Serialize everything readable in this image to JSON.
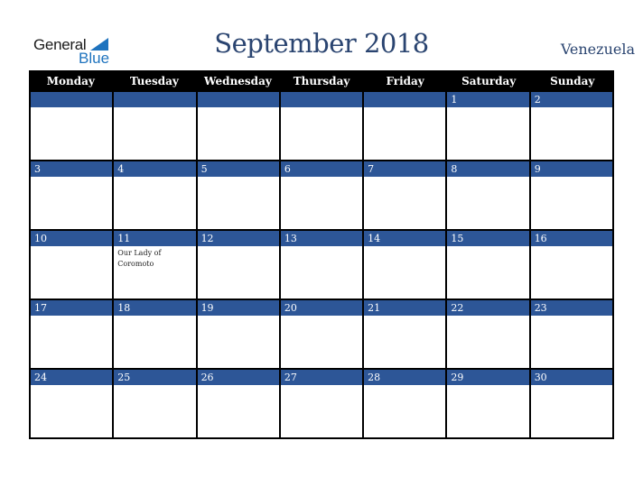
{
  "logo": {
    "line1": "General",
    "line2": "Blue"
  },
  "header": {
    "title": "September 2018",
    "country": "Venezuela"
  },
  "weekdays": [
    "Monday",
    "Tuesday",
    "Wednesday",
    "Thursday",
    "Friday",
    "Saturday",
    "Sunday"
  ],
  "weeks": [
    [
      {
        "day": ""
      },
      {
        "day": ""
      },
      {
        "day": ""
      },
      {
        "day": ""
      },
      {
        "day": ""
      },
      {
        "day": "1"
      },
      {
        "day": "2"
      }
    ],
    [
      {
        "day": "3"
      },
      {
        "day": "4"
      },
      {
        "day": "5"
      },
      {
        "day": "6"
      },
      {
        "day": "7"
      },
      {
        "day": "8"
      },
      {
        "day": "9"
      }
    ],
    [
      {
        "day": "10"
      },
      {
        "day": "11",
        "event": "Our Lady of Coromoto"
      },
      {
        "day": "12"
      },
      {
        "day": "13"
      },
      {
        "day": "14"
      },
      {
        "day": "15"
      },
      {
        "day": "16"
      }
    ],
    [
      {
        "day": "17"
      },
      {
        "day": "18"
      },
      {
        "day": "19"
      },
      {
        "day": "20"
      },
      {
        "day": "21"
      },
      {
        "day": "22"
      },
      {
        "day": "23"
      }
    ],
    [
      {
        "day": "24"
      },
      {
        "day": "25"
      },
      {
        "day": "26"
      },
      {
        "day": "27"
      },
      {
        "day": "28"
      },
      {
        "day": "29"
      },
      {
        "day": "30"
      }
    ]
  ],
  "colors": {
    "accent": "#2d5697",
    "header_bg": "#000000",
    "title": "#2a4470",
    "logo_blue": "#1e73be"
  }
}
